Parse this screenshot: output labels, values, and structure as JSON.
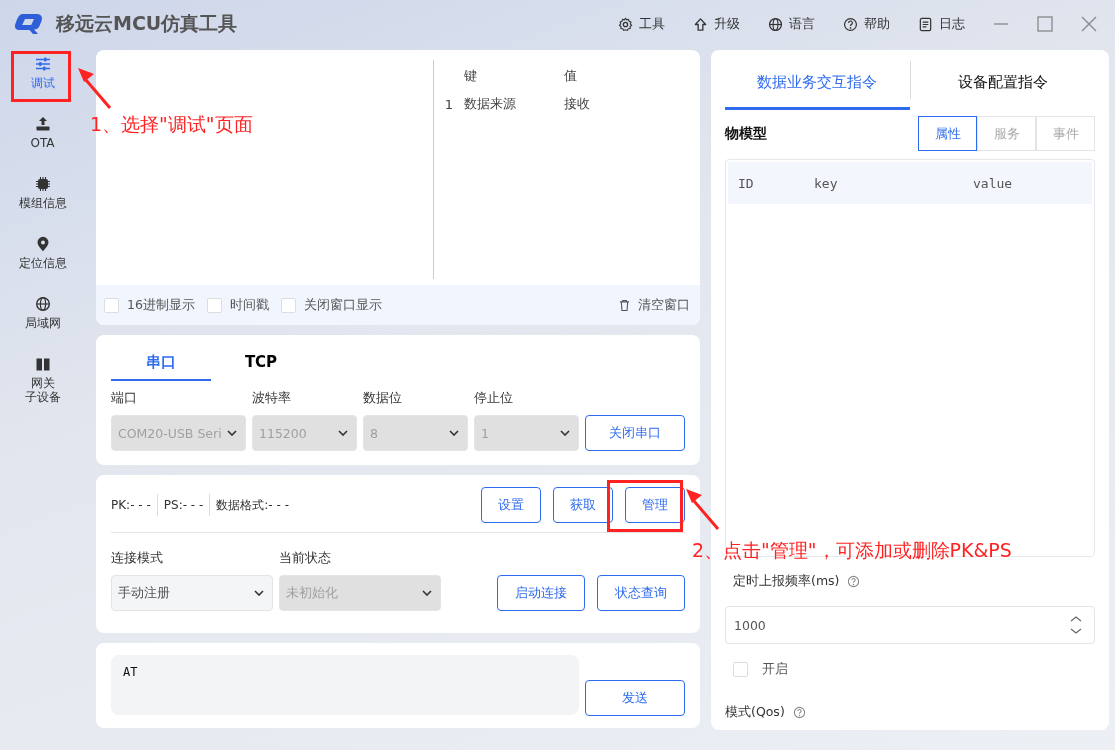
{
  "window": {
    "title": "移远云MCU仿真工具"
  },
  "toolbar": [
    {
      "kind": "gear",
      "label": "工具"
    },
    {
      "kind": "up",
      "label": "升级"
    },
    {
      "kind": "globe",
      "label": "语言"
    },
    {
      "kind": "help",
      "label": "帮助"
    },
    {
      "kind": "doc",
      "label": "日志"
    }
  ],
  "sidebar": {
    "items": [
      {
        "kind": "sliders",
        "label": "调试",
        "selected": true
      },
      {
        "kind": "upload",
        "label": "OTA",
        "selected": false
      },
      {
        "kind": "chip",
        "label": "模组信息",
        "selected": false
      },
      {
        "kind": "pin",
        "label": "定位信息",
        "selected": false
      },
      {
        "kind": "globe",
        "label": "局域网",
        "selected": false
      },
      {
        "kind": "book",
        "lines": [
          "网关",
          "子设备"
        ],
        "selected": false
      }
    ]
  },
  "log": {
    "columns": [
      "键",
      "值"
    ],
    "rows": [
      {
        "index": "1",
        "key": "数据来源",
        "value": "接收"
      }
    ],
    "options": [
      {
        "label": "16进制显示",
        "checked": false
      },
      {
        "label": "时间戳",
        "checked": false
      },
      {
        "label": "关闭窗口显示",
        "checked": false
      }
    ],
    "clear": "清空窗口"
  },
  "connection": {
    "tabs": [
      {
        "label": "串口",
        "selected": true
      },
      {
        "label": "TCP",
        "selected": false
      }
    ],
    "fields": [
      {
        "label": "端口",
        "value": "COM20-USB Seri",
        "disabled": true
      },
      {
        "label": "波特率",
        "value": "115200",
        "disabled": true
      },
      {
        "label": "数据位",
        "value": "8",
        "disabled": true
      },
      {
        "label": "停止位",
        "value": "1",
        "disabled": true
      }
    ],
    "button": "关闭串口"
  },
  "product": {
    "info": [
      "PK:- - -",
      "PS:- - -",
      "数据格式:- - -"
    ],
    "buttons": [
      "设置",
      "获取",
      "管理"
    ],
    "fields": [
      {
        "label": "连接模式",
        "value": "手动注册",
        "disabled": false
      },
      {
        "label": "当前状态",
        "value": "未初始化",
        "disabled": true
      }
    ],
    "actions": [
      "启动连接",
      "状态查询"
    ]
  },
  "command": {
    "value": "AT",
    "button": "发送"
  },
  "right_panel": {
    "tabs": [
      {
        "label": "数据业务交互指令",
        "selected": true
      },
      {
        "label": "设备配置指令",
        "selected": false
      }
    ],
    "section": "物模型",
    "segments": [
      {
        "label": "属性",
        "selected": true
      },
      {
        "label": "服务",
        "selected": false
      },
      {
        "label": "事件",
        "selected": false
      }
    ],
    "columns": [
      "ID",
      "key",
      "value"
    ],
    "interval_label": "定时上报频率(ms)",
    "interval_value": "1000",
    "enable": {
      "label": "开启",
      "checked": false
    },
    "qos_label": "模式(Qos)"
  },
  "annotations": [
    {
      "text": "1、选择\"调试\"页面"
    },
    {
      "text": "2、点击\"管理\"，可添加或删除PK&PS"
    }
  ]
}
